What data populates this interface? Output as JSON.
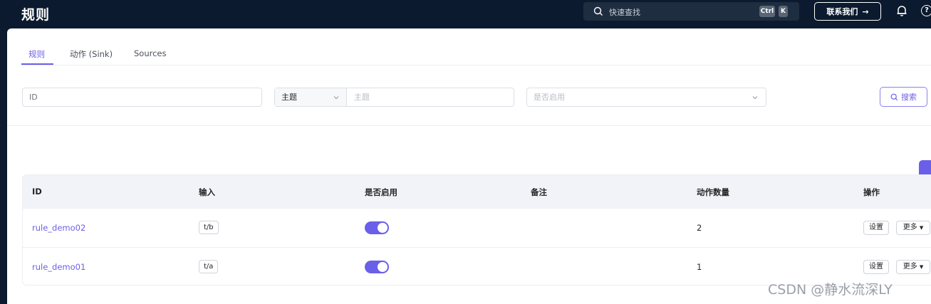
{
  "app": {
    "title": "规则"
  },
  "header": {
    "search_placeholder": "快速查找",
    "shortcut_ctrl": "Ctrl",
    "shortcut_k": "K",
    "contact_label": "联系我们",
    "contact_arrow": "→",
    "help_glyph": "?"
  },
  "tabs": [
    {
      "label": "规则",
      "active": true
    },
    {
      "label": "动作 (Sink)",
      "active": false
    },
    {
      "label": "Sources",
      "active": false
    }
  ],
  "filters": {
    "id_placeholder": "ID",
    "topic_select_value": "主题",
    "topic_placeholder": "主题",
    "enabled_placeholder": "是否启用",
    "search_button": "搜索"
  },
  "table": {
    "columns": [
      "ID",
      "输入",
      "是否启用",
      "备注",
      "动作数量",
      "操作"
    ],
    "rows": [
      {
        "id": "rule_demo02",
        "input": "t/b",
        "enabled": true,
        "note": "",
        "action_count": "2",
        "settings": "设置",
        "more": "更多"
      },
      {
        "id": "rule_demo01",
        "input": "t/a",
        "enabled": true,
        "note": "",
        "action_count": "1",
        "settings": "设置",
        "more": "更多"
      }
    ]
  },
  "watermark": "CSDN @静水流深LY",
  "colors": {
    "accent": "#6a5fe8",
    "topbar": "#0b1a2e"
  }
}
